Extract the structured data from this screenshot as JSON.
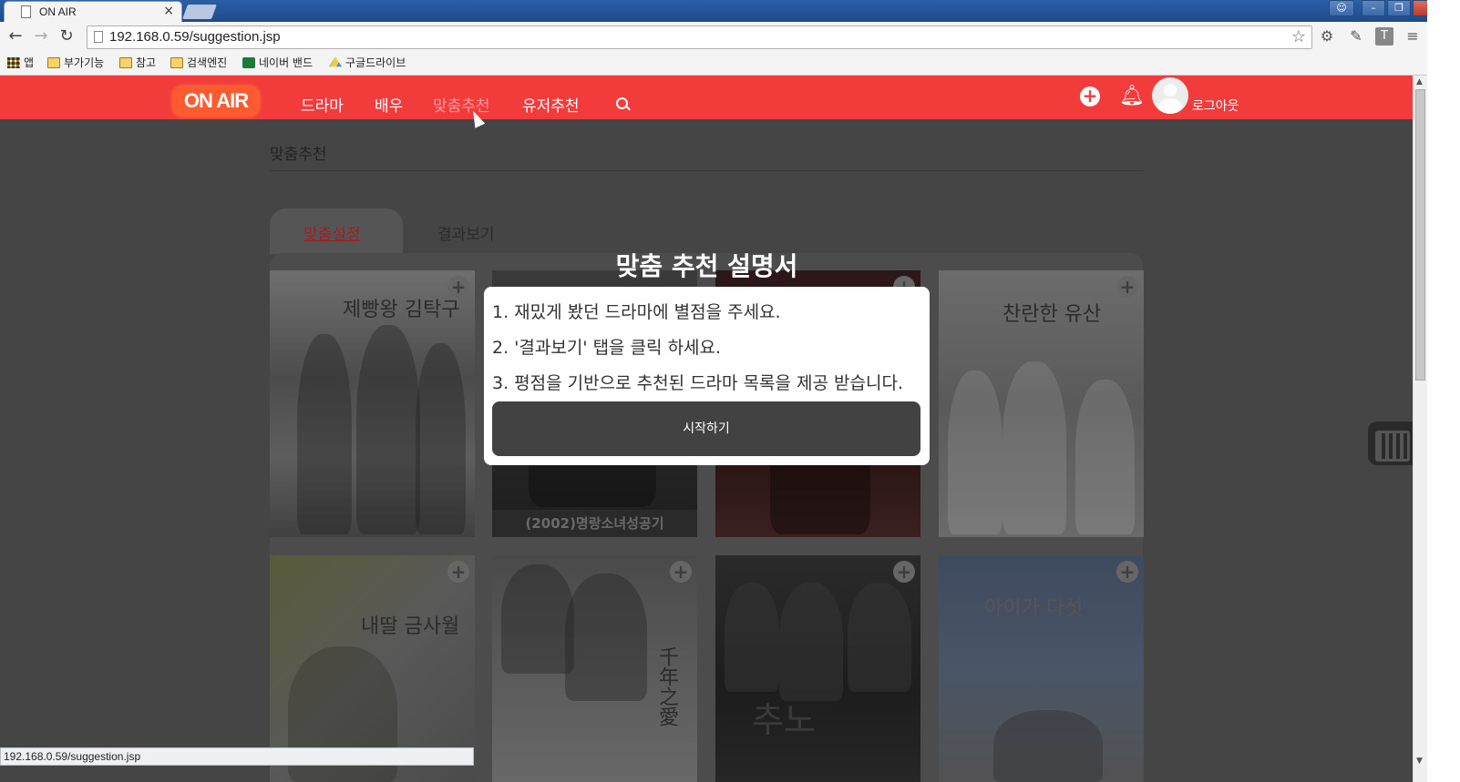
{
  "browser": {
    "tab_title": "ON AIR",
    "tab_close": "×",
    "url": "192.168.0.59/suggestion.jsp",
    "status_url": "192.168.0.59/suggestion.jsp",
    "bookmarks": [
      "앱",
      "부가기능",
      "참고",
      "검색엔진",
      "네이버 밴드",
      "구글드라이브"
    ],
    "toolbar_icons": [
      "back-icon",
      "forward-icon",
      "reload-icon",
      "star-icon",
      "settings-icon",
      "extension-icon",
      "t-icon",
      "menu-icon"
    ]
  },
  "header": {
    "logo": "ON AIR",
    "nav": [
      "드라마",
      "배우",
      "맞춤추천",
      "유저추천"
    ],
    "active_nav": "맞춤추천",
    "logout": "로그아웃",
    "brand_color": "#f23b3b"
  },
  "page": {
    "title": "맞춤추천",
    "tabs": [
      "맞춤설정",
      "결과보기"
    ],
    "active_tab": "맞춤설정"
  },
  "posters": [
    {
      "title": "제빵왕 김탁구",
      "caption": ""
    },
    {
      "title": "",
      "caption": "(2002)명랑소녀성공기"
    },
    {
      "title": "",
      "caption": ""
    },
    {
      "title": "찬란한 유산",
      "caption": ""
    },
    {
      "title": "내딸 금사월",
      "caption": ""
    },
    {
      "title": "千年之愛",
      "caption": ""
    },
    {
      "title": "추노",
      "caption": ""
    },
    {
      "title": "아이가 다섯",
      "caption": ""
    }
  ],
  "modal": {
    "heading": "맞춤 추천 설명서",
    "steps": [
      "1. 재밌게 봤던 드라마에 별점을 주세요.",
      "2. '결과보기' 탭을 클릭 하세요.",
      "3. 평점을 기반으로 추천된 드라마 목록을 제공 받습니다."
    ],
    "start_button": "시작하기"
  }
}
